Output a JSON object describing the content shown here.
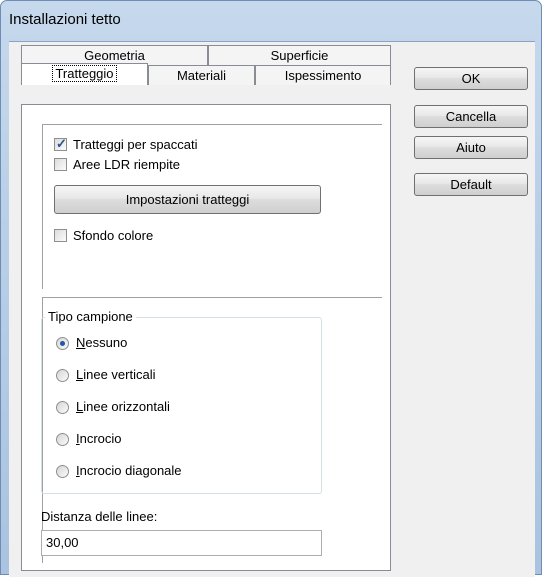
{
  "window": {
    "title": "Installazioni tetto"
  },
  "tabs": {
    "row1": [
      {
        "label": "Geometria"
      },
      {
        "label": "Superficie"
      }
    ],
    "row2": [
      {
        "label": "Tratteggio"
      },
      {
        "label": "Materiali"
      },
      {
        "label": "Ispessimento"
      }
    ],
    "active": "Tratteggio"
  },
  "hatch": {
    "checkbox_hatch_sections": {
      "label": "Tratteggi per spaccati",
      "checked": true
    },
    "checkbox_filled_ldr": {
      "label": "Aree LDR riempite",
      "checked": false
    },
    "settings_button": "Impostazioni tratteggi",
    "checkbox_bg_color": {
      "label": "Sfondo colore",
      "checked": false
    }
  },
  "pattern": {
    "legend": "Tipo campione",
    "options": [
      {
        "accel": "N",
        "rest": "essuno",
        "selected": true
      },
      {
        "accel": "L",
        "rest": "inee verticali",
        "selected": false
      },
      {
        "accel": "L",
        "rest": "inee orizzontali",
        "selected": false
      },
      {
        "accel": "I",
        "rest": "ncrocio",
        "selected": false
      },
      {
        "accel": "I",
        "rest": "ncrocio diagonale",
        "selected": false
      }
    ]
  },
  "line_distance": {
    "label": "Distanza delle linee:",
    "value": "30,00"
  },
  "buttons": {
    "ok": "OK",
    "cancel": "Cancella",
    "help": "Aiuto",
    "default": "Default"
  },
  "check_mark": "✓"
}
